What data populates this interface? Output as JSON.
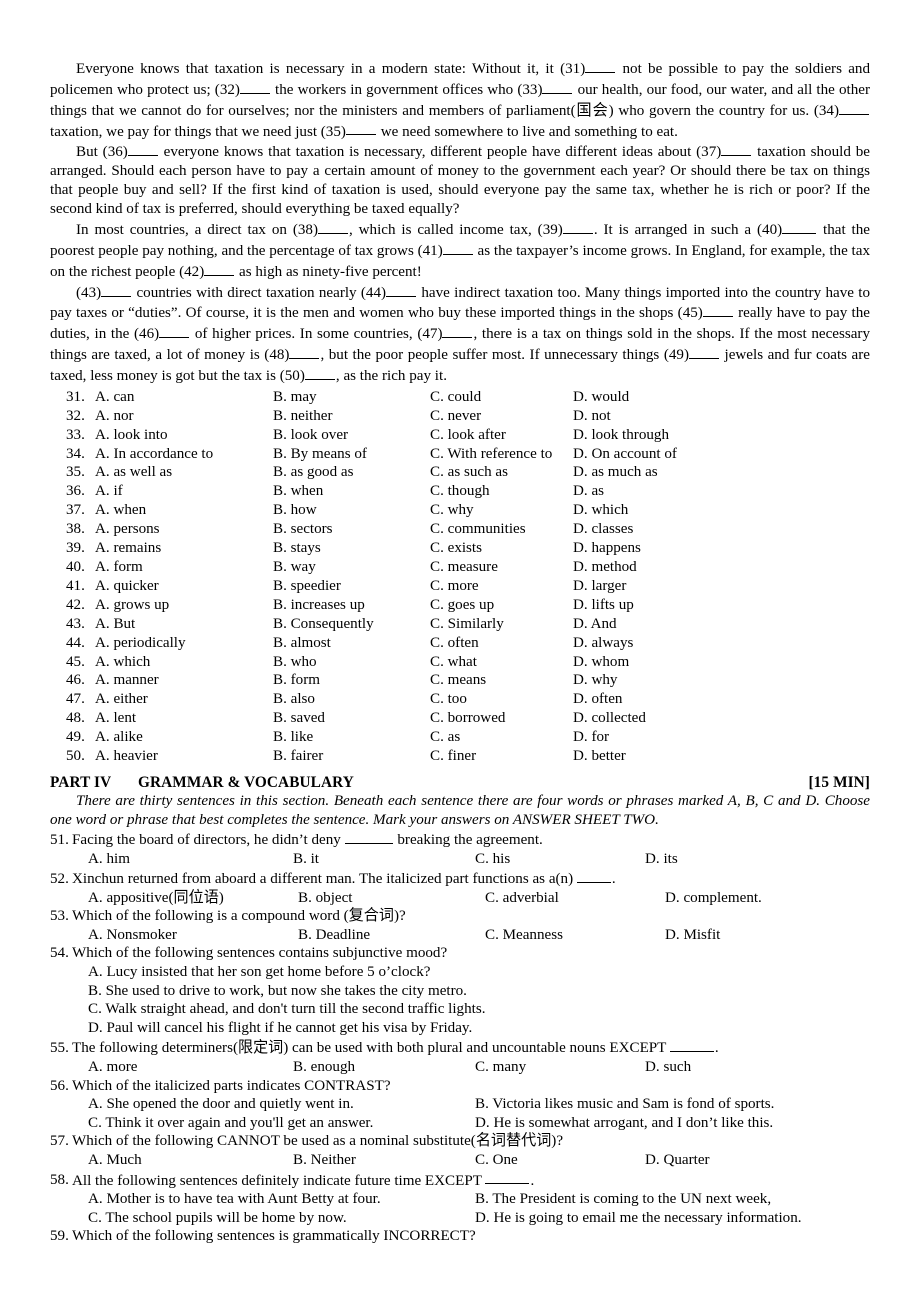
{
  "passage": {
    "paragraphs": [
      [
        {
          "t": "Everyone knows that taxation is necessary in a modern state: Without it, it (31)"
        },
        {
          "blank": "sm"
        },
        {
          "t": " not be possible to pay the soldiers and policemen who protect us; (32)"
        },
        {
          "blank": "sm"
        },
        {
          "t": " the workers in government offices who (33)"
        },
        {
          "blank": "sm"
        },
        {
          "t": " our health, our food, our water, and all the other things that we cannot do for ourselves; nor the ministers and members of parliament(国会) who govern the country for us. (34)"
        },
        {
          "blank": "sm"
        },
        {
          "t": " taxation, we pay for things that we need just (35)"
        },
        {
          "blank": "sm"
        },
        {
          "t": " we need somewhere to live and something to eat."
        }
      ],
      [
        {
          "t": "But (36)"
        },
        {
          "blank": "sm"
        },
        {
          "t": " everyone knows that taxation is necessary, different people have different ideas about (37)"
        },
        {
          "blank": "sm"
        },
        {
          "t": " taxation should be arranged. Should each person have to pay a certain amount of money to the government each year? Or should there be tax on things that people buy and sell? If the first kind of taxation is used, should everyone pay the same tax, whether he is rich or poor? If the second kind of tax is preferred, should everything be taxed equally?"
        }
      ],
      [
        {
          "t": "In most countries, a direct tax on (38)"
        },
        {
          "blank": "sm"
        },
        {
          "t": ", which is called income tax, (39)"
        },
        {
          "blank": "sm"
        },
        {
          "t": ". It is arranged in such a (40)"
        },
        {
          "blank": "md"
        },
        {
          "t": " that the poorest people pay nothing, and the percentage of tax grows (41)"
        },
        {
          "blank": "sm"
        },
        {
          "t": " as the taxpayer’s income grows. In England, for example, the tax on the richest people (42)"
        },
        {
          "blank": "sm"
        },
        {
          "t": " as high as ninety-five percent!"
        }
      ],
      [
        {
          "t": "(43)"
        },
        {
          "blank": "sm"
        },
        {
          "t": " countries with direct taxation nearly (44)"
        },
        {
          "blank": "sm"
        },
        {
          "t": " have indirect taxation too. Many things imported into the country have to pay taxes or “duties”. Of course, it is the men and women who buy these imported things in the shops (45)"
        },
        {
          "blank": "sm"
        },
        {
          "t": " really have to pay the duties, in the (46)"
        },
        {
          "blank": "sm"
        },
        {
          "t": " of higher prices. In some countries, (47)"
        },
        {
          "blank": "sm"
        },
        {
          "t": ", there is a tax on things sold in the shops. If the most necessary things are taxed, a lot of money is (48)"
        },
        {
          "blank": "sm"
        },
        {
          "t": ", but the poor people suffer most. If unnecessary things (49)"
        },
        {
          "blank": "sm"
        },
        {
          "t": " jewels and fur coats are taxed, less money is got but the tax is (50)"
        },
        {
          "blank": "sm"
        },
        {
          "t": ", as the rich pay it."
        }
      ]
    ]
  },
  "cloze_options": [
    {
      "num": "31.",
      "a": "A. can",
      "b": "B. may",
      "c": "C. could",
      "d": "D. would"
    },
    {
      "num": "32.",
      "a": "A. nor",
      "b": "B. neither",
      "c": "C. never",
      "d": "D. not"
    },
    {
      "num": "33.",
      "a": "A. look into",
      "b": "B. look over",
      "c": "C. look after",
      "d": "D. look through"
    },
    {
      "num": "34.",
      "a": "A. In accordance to",
      "b": "B. By means of",
      "c": "C. With reference to",
      "d": "D. On account of"
    },
    {
      "num": "35.",
      "a": "A. as well as",
      "b": "B. as good as",
      "c": "C. as such as",
      "d": "D. as much as"
    },
    {
      "num": "36.",
      "a": "A. if",
      "b": "B. when",
      "c": "C. though",
      "d": "D. as"
    },
    {
      "num": "37.",
      "a": "A. when",
      "b": "B. how",
      "c": "C. why",
      "d": "D. which"
    },
    {
      "num": "38.",
      "a": "A. persons",
      "b": "B. sectors",
      "c": "C. communities",
      "d": "D. classes"
    },
    {
      "num": "39.",
      "a": "A. remains",
      "b": "B. stays",
      "c": "C. exists",
      "d": "D. happens"
    },
    {
      "num": "40.",
      "a": "A. form",
      "b": "B. way",
      "c": "C. measure",
      "d": "D. method"
    },
    {
      "num": "41.",
      "a": "A. quicker",
      "b": "B. speedier",
      "c": "C. more",
      "d": "D. larger"
    },
    {
      "num": "42.",
      "a": "A. grows up",
      "b": "B. increases up",
      "c": "C. goes up",
      "d": "D. lifts up"
    },
    {
      "num": "43.",
      "a": "A. But",
      "b": "B. Consequently",
      "c": "C. Similarly",
      "d": "D. And"
    },
    {
      "num": "44.",
      "a": "A. periodically",
      "b": "B. almost",
      "c": "C. often",
      "d": "D. always"
    },
    {
      "num": "45.",
      "a": "A. which",
      "b": "B. who",
      "c": "C. what",
      "d": "D. whom"
    },
    {
      "num": "46.",
      "a": "A. manner",
      "b": "B. form",
      "c": "C. means",
      "d": "D. why"
    },
    {
      "num": "47.",
      "a": "A. either",
      "b": "B. also",
      "c": "C. too",
      "d": "D. often"
    },
    {
      "num": "48.",
      "a": "A. lent",
      "b": "B. saved",
      "c": "C. borrowed",
      "d": "D. collected"
    },
    {
      "num": "49.",
      "a": "A. alike",
      "b": "B. like",
      "c": "C. as",
      "d": "D. for"
    },
    {
      "num": "50.",
      "a": "A. heavier",
      "b": "B. fairer",
      "c": "C. finer",
      "d": "D. better"
    }
  ],
  "part4": {
    "label": "PART IV",
    "title": "GRAMMAR & VOCABULARY",
    "time": "[15 MIN]",
    "directions_line1": "There are thirty sentences in this section. Beneath each sentence there are four words or phrases marked A, B, C and D.",
    "directions_line2": "Choose one word or phrase that best completes the sentence. Mark your answers on ANSWER SHEET TWO."
  },
  "questions": {
    "q51": {
      "num": "51.",
      "stem_before": "Facing the board of directors, he didn’t deny ",
      "stem_after": " breaking the agreement.",
      "a": "A. him",
      "b": "B. it",
      "c": "C. his",
      "d": "D. its"
    },
    "q52": {
      "num": "52.",
      "stem_before": "Xinchun returned from aboard a different man. The italicized part functions as a(n) ",
      "stem_after": ".",
      "a": "A. appositive(同位语)",
      "b": "B. object",
      "c": "C. adverbial",
      "d": "D. complement."
    },
    "q53": {
      "num": "53.",
      "stem": "Which of the following is a compound word (复合词)?",
      "a": "A. Nonsmoker",
      "b": "B. Deadline",
      "c": "C. Meanness",
      "d": "D. Misfit"
    },
    "q54": {
      "num": "54.",
      "stem": "Which of the following sentences contains subjunctive mood?",
      "a": "A. Lucy insisted that her son get home before 5 o’clock?",
      "b": "B. She used to drive to work, but now she takes the city metro.",
      "c": "C. Walk straight ahead, and don't turn till the second traffic lights.",
      "d": "D. Paul will cancel his flight if he cannot get his visa by Friday."
    },
    "q55": {
      "num": "55.",
      "stem_before": "The following determiners(限定词) can be used with both plural and uncountable nouns EXCEPT ",
      "stem_after": ".",
      "a": "A. more",
      "b": "B. enough",
      "c": "C. many",
      "d": "D. such"
    },
    "q56": {
      "num": "56.",
      "stem": "Which of the italicized parts indicates CONTRAST?",
      "a": "A. She opened the door and quietly went in.",
      "b": "B. Victoria likes music and Sam is fond of sports.",
      "c": "C. Think it over again and you'll get an answer.",
      "d": "D. He is somewhat arrogant, and I don’t like this."
    },
    "q57": {
      "num": "57.",
      "stem": "Which of the following CANNOT be used as a nominal substitute(名词替代词)?",
      "a": "A. Much",
      "b": "B. Neither",
      "c": "C. One",
      "d": "D. Quarter"
    },
    "q58": {
      "num": "58.",
      "stem_before": "All the following sentences definitely indicate future time EXCEPT ",
      "stem_after": ".",
      "a": "A. Mother is to have tea with Aunt Betty at four.",
      "b": "B. The President is coming to the UN next week,",
      "c": "C. The school pupils will be home by now.",
      "d": "D. He is going to email me the necessary information."
    },
    "q59": {
      "num": "59.",
      "stem": "Which of the following sentences is grammatically INCORRECT?"
    }
  }
}
